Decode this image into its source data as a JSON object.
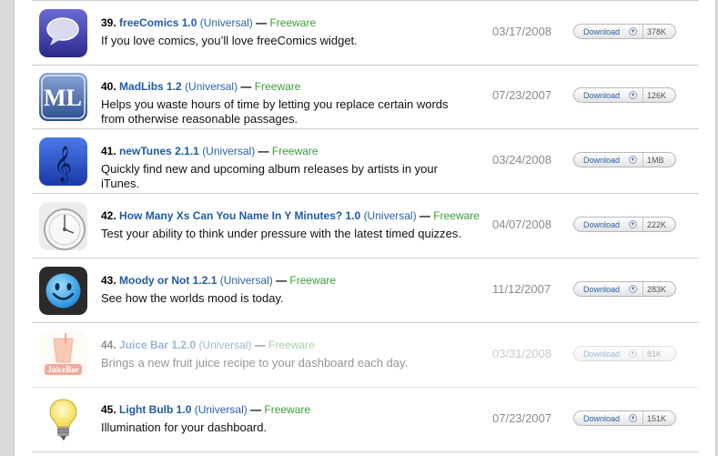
{
  "items": [
    {
      "num": "39.",
      "name": "freeComics 1.0",
      "universal": "(Universal)",
      "license": "Freeware",
      "desc": "If you love comics, you’ll love freeComics widget.",
      "date": "03/17/2008",
      "download": "Download",
      "size": "378K"
    },
    {
      "num": "40.",
      "name": "MadLibs 1.2",
      "universal": "(Universal)",
      "license": "Freeware",
      "desc": "Helps you waste hours of time by letting you replace certain words from otherwise reasonable passages.",
      "date": "07/23/2007",
      "download": "Download",
      "size": "126K"
    },
    {
      "num": "41.",
      "name": "newTunes 2.1.1",
      "universal": "(Universal)",
      "license": "Freeware",
      "desc": "Quickly find new and upcoming album releases by artists in your iTunes.",
      "date": "03/24/2008",
      "download": "Download",
      "size": "1MB"
    },
    {
      "num": "42.",
      "name": "How Many Xs Can You Name In Y Minutes? 1.0",
      "universal": "(Universal)",
      "license": "Freeware",
      "desc": "Test your ability to think under pressure with the latest timed quizzes.",
      "date": "04/07/2008",
      "download": "Download",
      "size": "222K"
    },
    {
      "num": "43.",
      "name": "Moody or Not 1.2.1",
      "universal": "(Universal)",
      "license": "Freeware",
      "desc": "See how the worlds mood is today.",
      "date": "11/12/2007",
      "download": "Download",
      "size": "283K"
    },
    {
      "num": "44.",
      "name": "Juice Bar 1.2.0",
      "universal": "(Universal)",
      "license": "Freeware",
      "desc": "Brings a new fruit juice recipe to your dashboard each day.",
      "date": "03/31/2008",
      "download": "Download",
      "size": "81K"
    },
    {
      "num": "45.",
      "name": "Light Bulb 1.0",
      "universal": "(Universal)",
      "license": "Freeware",
      "desc": "Illumination for your dashboard.",
      "date": "07/23/2007",
      "download": "Download",
      "size": "151K"
    }
  ],
  "icons": {
    "download_chevron": "chevron-down-icon"
  },
  "colors": {
    "link_blue": "#1e5ba8",
    "freeware_green": "#3a9a3a",
    "date_gray": "#8a8a8a"
  },
  "thumb_text": {
    "madlibs": "ML",
    "juicebar": "JuiceBar"
  }
}
